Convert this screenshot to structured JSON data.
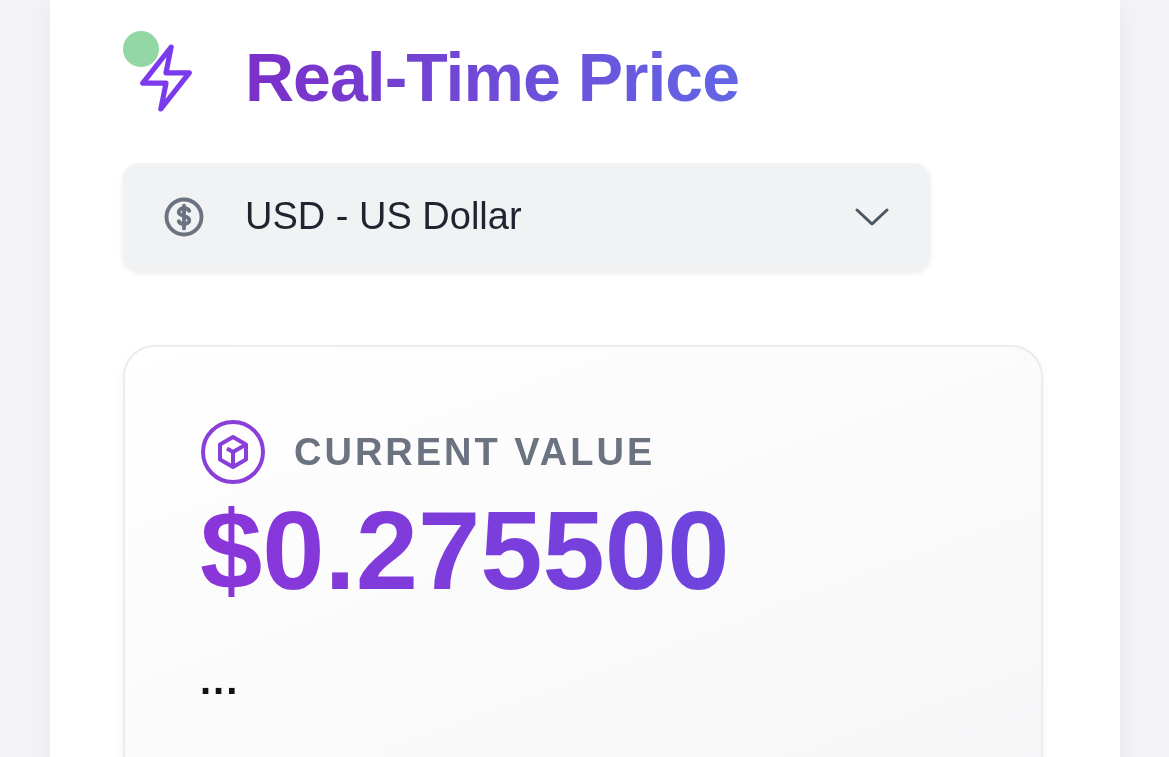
{
  "header": {
    "title": "Real-Time Price",
    "status_dot": {
      "color": "#93d8a4"
    }
  },
  "currency_select": {
    "value": "USD - US Dollar"
  },
  "price_card": {
    "label": "CURRENT VALUE",
    "value": "$0.275500",
    "more": "..."
  }
}
